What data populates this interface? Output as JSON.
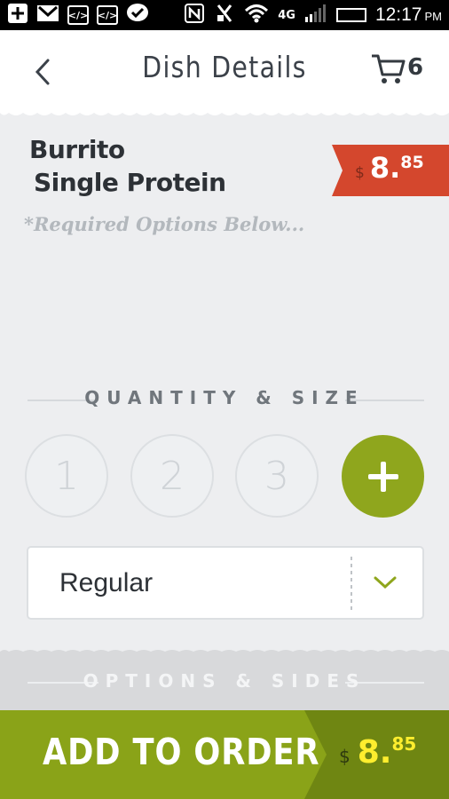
{
  "status_bar": {
    "time": "12:17",
    "ampm": "PM",
    "network": "4G"
  },
  "header": {
    "title": "Dish Details",
    "cart_count": "6"
  },
  "dish": {
    "name_line1": "Burrito",
    "name_line2": "Single Protein",
    "required_note": "*Required Options Below...",
    "price_currency": "$",
    "price_main": "8.",
    "price_cents": "85"
  },
  "quantity": {
    "heading": "QUANTITY & SIZE",
    "options": [
      "1",
      "2",
      "3"
    ]
  },
  "size_select": {
    "value": "Regular"
  },
  "options_section": {
    "heading": "OPTIONS & SIDES"
  },
  "order_button": {
    "label": "ADD TO ORDER",
    "price_currency": "$",
    "price_main": "8.",
    "price_cents": "85"
  },
  "colors": {
    "accent_green": "#8fa61d",
    "price_tag_red": "#d4472d",
    "total_yellow": "#ffee2e"
  }
}
